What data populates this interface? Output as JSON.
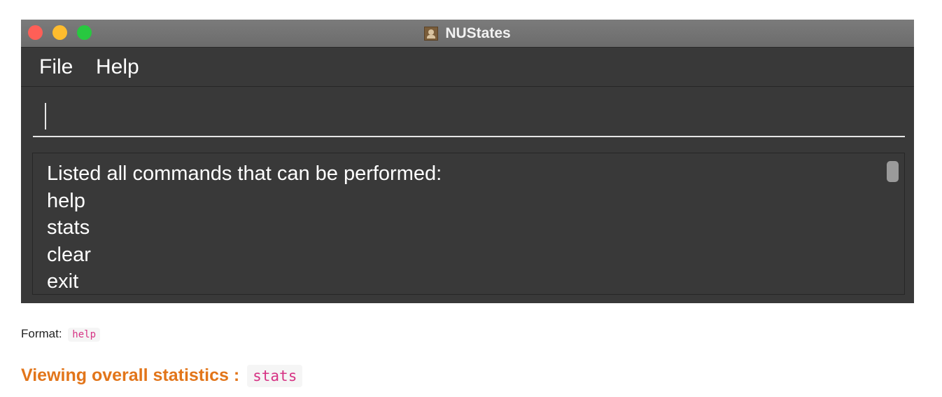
{
  "window": {
    "title": "NUStates",
    "app_icon": "address-book-icon"
  },
  "menu": {
    "file_label": "File",
    "help_label": "Help"
  },
  "command_box": {
    "value": ""
  },
  "result": {
    "lines": [
      "Listed all commands that can be performed:",
      "help",
      "stats",
      "clear",
      "exit"
    ]
  },
  "doc": {
    "format_label": "Format:",
    "format_code": "help",
    "heading_text": "Viewing overall statistics :",
    "heading_code": "stats"
  },
  "colors": {
    "window_bg": "#393939",
    "titlebar": "#6c6c6c",
    "close": "#fe5f57",
    "minimize": "#febc2e",
    "zoom": "#28c840",
    "heading": "#e2751a",
    "code": "#d63384"
  }
}
